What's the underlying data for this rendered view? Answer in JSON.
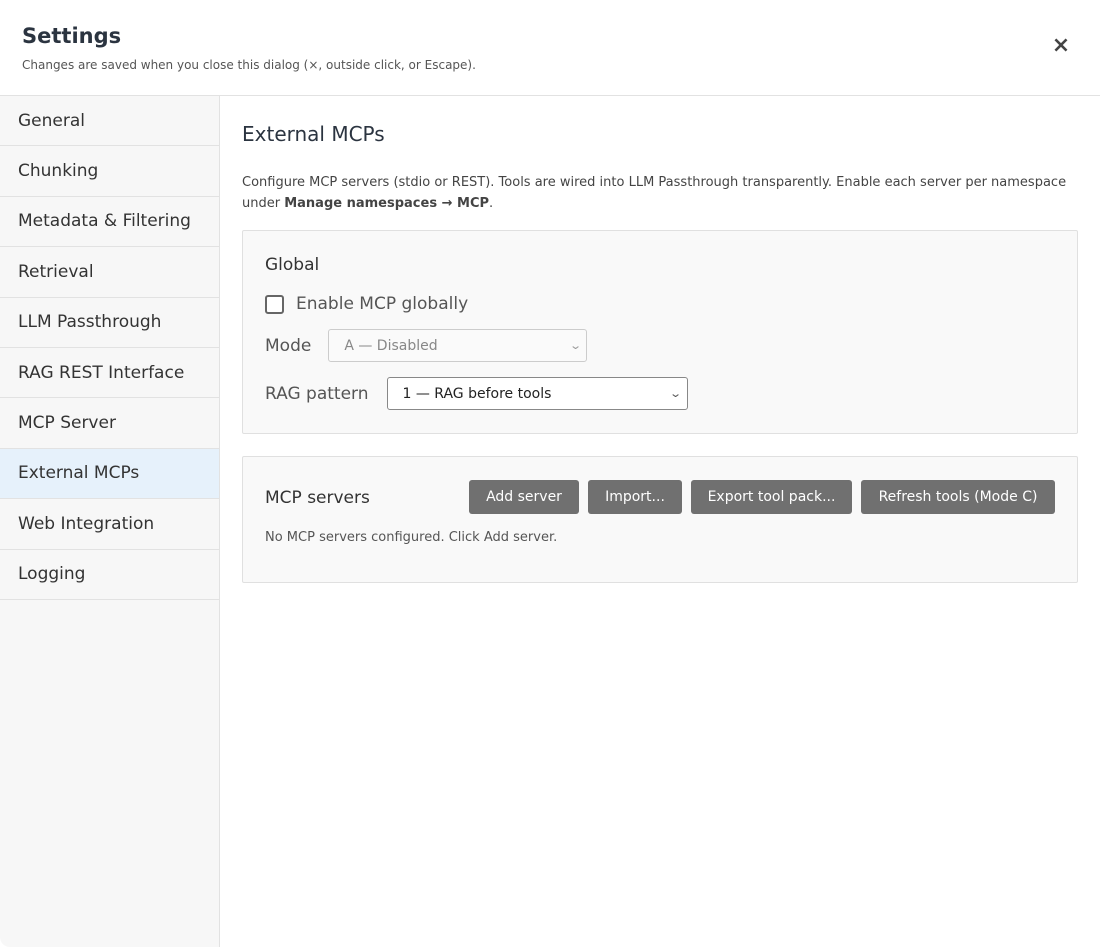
{
  "dialog": {
    "title": "Settings",
    "subtitle": "Changes are saved when you close this dialog (×, outside click, or Escape).",
    "close_glyph": "×"
  },
  "sidebar": {
    "items": [
      {
        "label": "General"
      },
      {
        "label": "Chunking"
      },
      {
        "label": "Metadata & Filtering"
      },
      {
        "label": "Retrieval"
      },
      {
        "label": "LLM Passthrough"
      },
      {
        "label": "RAG REST Interface"
      },
      {
        "label": "MCP Server"
      },
      {
        "label": "External MCPs",
        "active": true
      },
      {
        "label": "Web Integration"
      },
      {
        "label": "Logging"
      }
    ]
  },
  "main": {
    "title": "External MCPs",
    "description": "Configure MCP servers (stdio or REST). Tools are wired into LLM Passthrough transparently. Enable each server per namespace under ",
    "description_bold": "Manage namespaces → MCP",
    "description_end": ".",
    "global": {
      "title": "Global",
      "enable_label": "Enable MCP globally",
      "enable_checked": false,
      "mode_label": "Mode",
      "mode_value": "A — Disabled",
      "rag_pattern_label": "RAG pattern",
      "rag_pattern_value": "1 — RAG before tools"
    },
    "servers": {
      "title": "MCP servers",
      "add_label": "Add server",
      "import_label": "Import...",
      "export_label": "Export tool pack...",
      "refresh_label": "Refresh tools (Mode C)",
      "empty_text": "No MCP servers configured. Click Add server."
    }
  },
  "colors": {
    "accent_active": "#e6f1fb",
    "button_bg": "#707070",
    "title_color": "#2b3440"
  }
}
